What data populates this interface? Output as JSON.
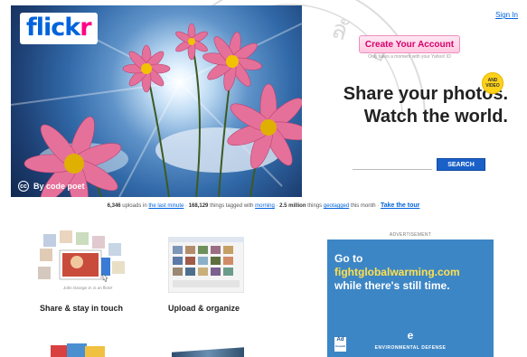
{
  "header": {
    "logo_flick": "flick",
    "logo_r": "r",
    "sign_in": "Sign In"
  },
  "hero": {
    "credit": "By code poet",
    "cc_icon": "creative-commons-icon"
  },
  "account": {
    "create_label": "Create Your Account",
    "create_sub": "Only takes a moment with your Yahoo! ID"
  },
  "tagline": {
    "line1": "Share your photos.",
    "line2": "Watch the world.",
    "badge_line1": "AND",
    "badge_line2": "VIDEO"
  },
  "search": {
    "placeholder": "",
    "button_label": "SEARCH"
  },
  "stats": {
    "uploads_count": "6,346",
    "uploads_text": "uploads in",
    "uploads_link": "the last minute",
    "tagged_count": "168,129",
    "tagged_text": "things tagged with",
    "tagged_link": "morning",
    "geo_count": "2.5 million",
    "geo_text": "things",
    "geo_link": "geotagged",
    "geo_suffix": "this month",
    "tour_link": "Take the tour"
  },
  "features": [
    {
      "caption": "Share & stay in touch",
      "icon": "share-photos-icon",
      "tooltip": "John George Jr. is on flickr!"
    },
    {
      "caption": "Upload & organize",
      "icon": "upload-organize-icon"
    }
  ],
  "ad": {
    "label": "ADVERTISEMENT",
    "line1": "Go to",
    "line2": "fightglobalwarming.com",
    "line3": "while there's still time.",
    "logo_letter": "e",
    "org": "ENVIRONMENTAL DEFENSE",
    "council_line1": "Ad",
    "council_line2": "Council"
  },
  "colors": {
    "flickr_blue": "#0063dc",
    "flickr_pink": "#ff0084",
    "ad_blue": "#3d86c6",
    "search_blue": "#1a60c8"
  }
}
